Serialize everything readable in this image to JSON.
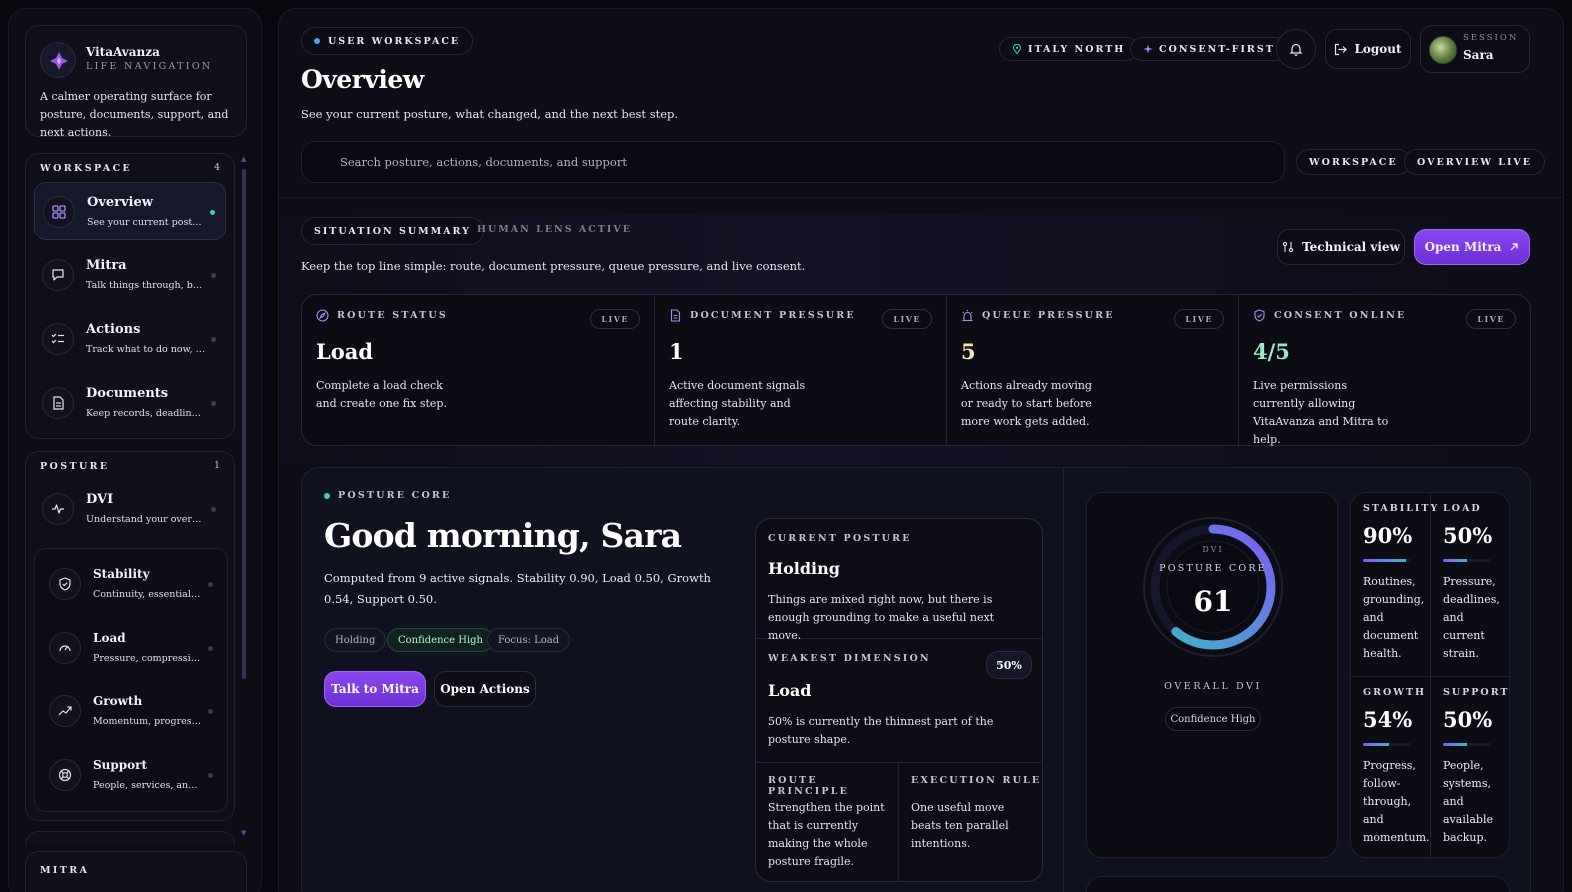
{
  "brand": {
    "name": "VitaAvanza",
    "subtitle": "LIFE NAVIGATION",
    "description": "A calmer operating surface for posture, documents, support, and next actions."
  },
  "sidebar": {
    "workspace": {
      "heading": "WORKSPACE",
      "count": "4",
      "items": [
        {
          "title": "Overview",
          "desc": "See your current posture, what changed, and the next best step.",
          "active": true
        },
        {
          "title": "Mitra",
          "desc": "Talk things through, build a plan.",
          "active": false
        },
        {
          "title": "Actions",
          "desc": "Track what to do now, what is moving.",
          "active": false
        },
        {
          "title": "Documents",
          "desc": "Keep records, deadlines, and proofs.",
          "active": false
        }
      ]
    },
    "posture": {
      "heading": "POSTURE",
      "count": "1",
      "dvi": {
        "title": "DVI",
        "desc": "Understand your overall posture."
      },
      "subitems": [
        {
          "title": "Stability",
          "desc": "Continuity, essential foundations."
        },
        {
          "title": "Load",
          "desc": "Pressure, compression, and strain."
        },
        {
          "title": "Growth",
          "desc": "Momentum, progress, and follow-through."
        },
        {
          "title": "Support",
          "desc": "People, services, and infrastructure."
        }
      ]
    },
    "mitra": {
      "heading": "MITRA"
    }
  },
  "header": {
    "workspace_pill": "USER WORKSPACE",
    "region_pill": "ITALY NORTH",
    "consent_pill": "CONSENT-FIRST",
    "logout_label": "Logout",
    "session_label": "SESSION",
    "user_name": "Sara",
    "title": "Overview",
    "subtitle": "See your current posture, what changed, and the next best step.",
    "search_placeholder": "Search posture, actions, documents, and support",
    "chip_workspace": "WORKSPACE",
    "chip_overview_live": "OVERVIEW LIVE"
  },
  "summary": {
    "tab_active": "SITUATION SUMMARY",
    "tab_inactive": "HUMAN LENS ACTIVE",
    "description": "Keep the top line simple: route, document pressure, queue pressure, and live consent.",
    "technical_view_label": "Technical view",
    "open_mitra_label": "Open Mitra",
    "cards": [
      {
        "label": "ROUTE STATUS",
        "badge": "LIVE",
        "value": "Load",
        "desc": "Complete a load check and create one fix step.",
        "value_color": "#ffffff"
      },
      {
        "label": "DOCUMENT PRESSURE",
        "badge": "LIVE",
        "value": "1",
        "desc": "Active document signals affecting stability and route clarity.",
        "value_color": "#ffffff"
      },
      {
        "label": "QUEUE PRESSURE",
        "badge": "LIVE",
        "value": "5",
        "desc": "Actions already moving or ready to start before more work gets added.",
        "value_color": "#f4e7b8"
      },
      {
        "label": "CONSENT ONLINE",
        "badge": "LIVE",
        "value": "4/5",
        "desc": "Live permissions currently allowing VitaAvanza and Mitra to help.",
        "value_color": "#9ee8c8"
      }
    ]
  },
  "posture": {
    "core_label": "POSTURE CORE",
    "greeting": "Good morning, Sara",
    "computed": "Computed from 9 active signals. Stability 0.90, Load 0.50, Growth 0.54, Support 0.50.",
    "tags": [
      "Holding",
      "Confidence High",
      "Focus: Load"
    ],
    "talk_label": "Talk to Mitra",
    "open_actions_label": "Open Actions",
    "current": {
      "label": "CURRENT POSTURE",
      "title": "Holding",
      "text": "Things are mixed right now, but there is enough grounding to make a useful next move."
    },
    "weakest": {
      "label": "WEAKEST DIMENSION",
      "badge": "50%",
      "title": "Load",
      "text": "50% is currently the thinnest part of the posture shape."
    },
    "route_principle": {
      "label": "ROUTE PRINCIPLE",
      "text": "Strengthen the point that is currently making the whole posture fragile."
    },
    "execution_rule": {
      "label": "EXECUTION RULE",
      "text": "One useful move beats ten parallel intentions."
    },
    "gauge": {
      "dvi_label": "DVI",
      "core_label": "POSTURE CORE",
      "score": "61",
      "score_fraction": 0.61,
      "overall_label": "OVERALL DVI",
      "confidence": "Confidence High"
    },
    "dimensions": [
      {
        "name": "STABILITY",
        "pct": "90%",
        "fill": 0.9,
        "text": "Routines, grounding, and document health."
      },
      {
        "name": "LOAD",
        "pct": "50%",
        "fill": 0.5,
        "text": "Pressure, deadlines, and current strain."
      },
      {
        "name": "GROWTH",
        "pct": "54%",
        "fill": 0.54,
        "text": "Progress, follow-through, and momentum."
      },
      {
        "name": "SUPPORT",
        "pct": "50%",
        "fill": 0.5,
        "text": "People, systems, and available backup."
      }
    ]
  },
  "colors": {
    "accent": "#8b47f0",
    "live_dot": "#34d6b4",
    "workspace_dot": "#4aa3e8"
  }
}
